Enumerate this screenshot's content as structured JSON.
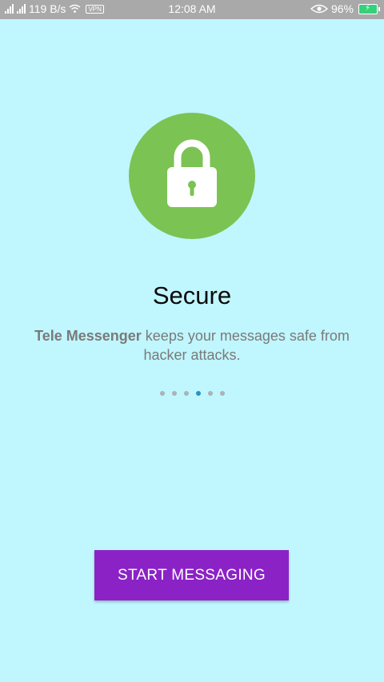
{
  "status_bar": {
    "network_speed": "119 B/s",
    "vpn_label": "VPN",
    "time": "12:08 AM",
    "battery_percent": "96%",
    "battery_level": 0.96,
    "icons": [
      "signal-icon",
      "signal-icon",
      "wifi-icon",
      "vpn-icon",
      "eye-icon",
      "battery-charging-icon"
    ]
  },
  "onboarding": {
    "illustration_icon": "lock-icon",
    "title": "Secure",
    "description_app_name": "Tele Messenger",
    "description_rest": " keeps your messages safe from hacker attacks.",
    "page_count": 6,
    "active_page_index": 3
  },
  "actions": {
    "start_label": "START MESSAGING"
  },
  "colors": {
    "background": "#c0f6fd",
    "status_bar": "#a9a9a9",
    "lock_circle": "#7bc353",
    "button": "#8b22c6",
    "active_dot": "#2c90c9",
    "inactive_dot": "#a8b4b6"
  }
}
